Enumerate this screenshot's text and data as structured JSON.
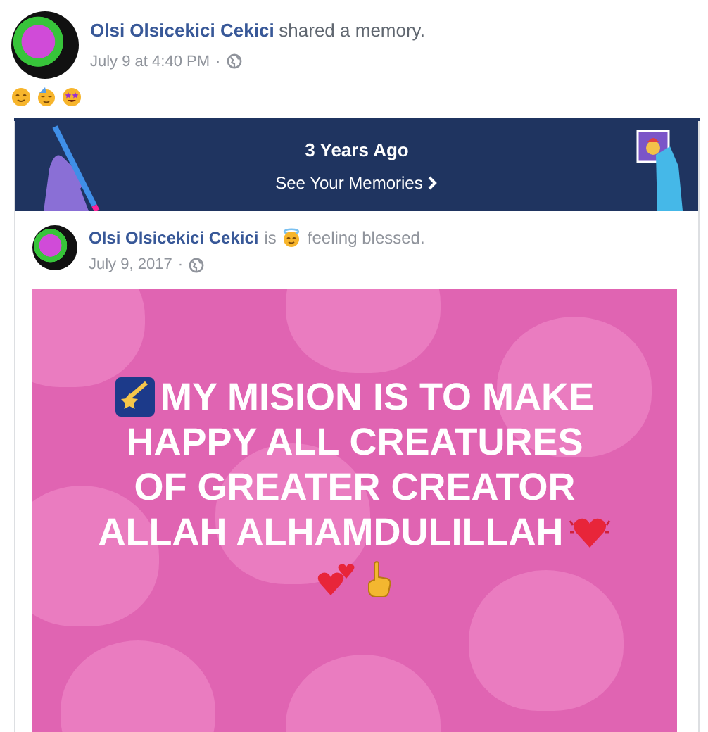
{
  "post": {
    "author": "Olsi Olsicekici Cekici",
    "action": "shared a memory.",
    "time": "July 9 at 4:40 PM",
    "separator": "·"
  },
  "memory": {
    "title": "3 Years Ago",
    "link": "See Your Memories"
  },
  "shared_post": {
    "author": "Olsi Olsicekici Cekici",
    "verb": "is",
    "feeling": "feeling blessed.",
    "date": "July 9, 2017",
    "separator": "·",
    "text_lines": [
      "MY MISION IS TO MAKE",
      "HAPPY ALL CREATURES",
      "OF GREATER CREATOR",
      "ALLAH ALHAMDULILLAH"
    ]
  }
}
